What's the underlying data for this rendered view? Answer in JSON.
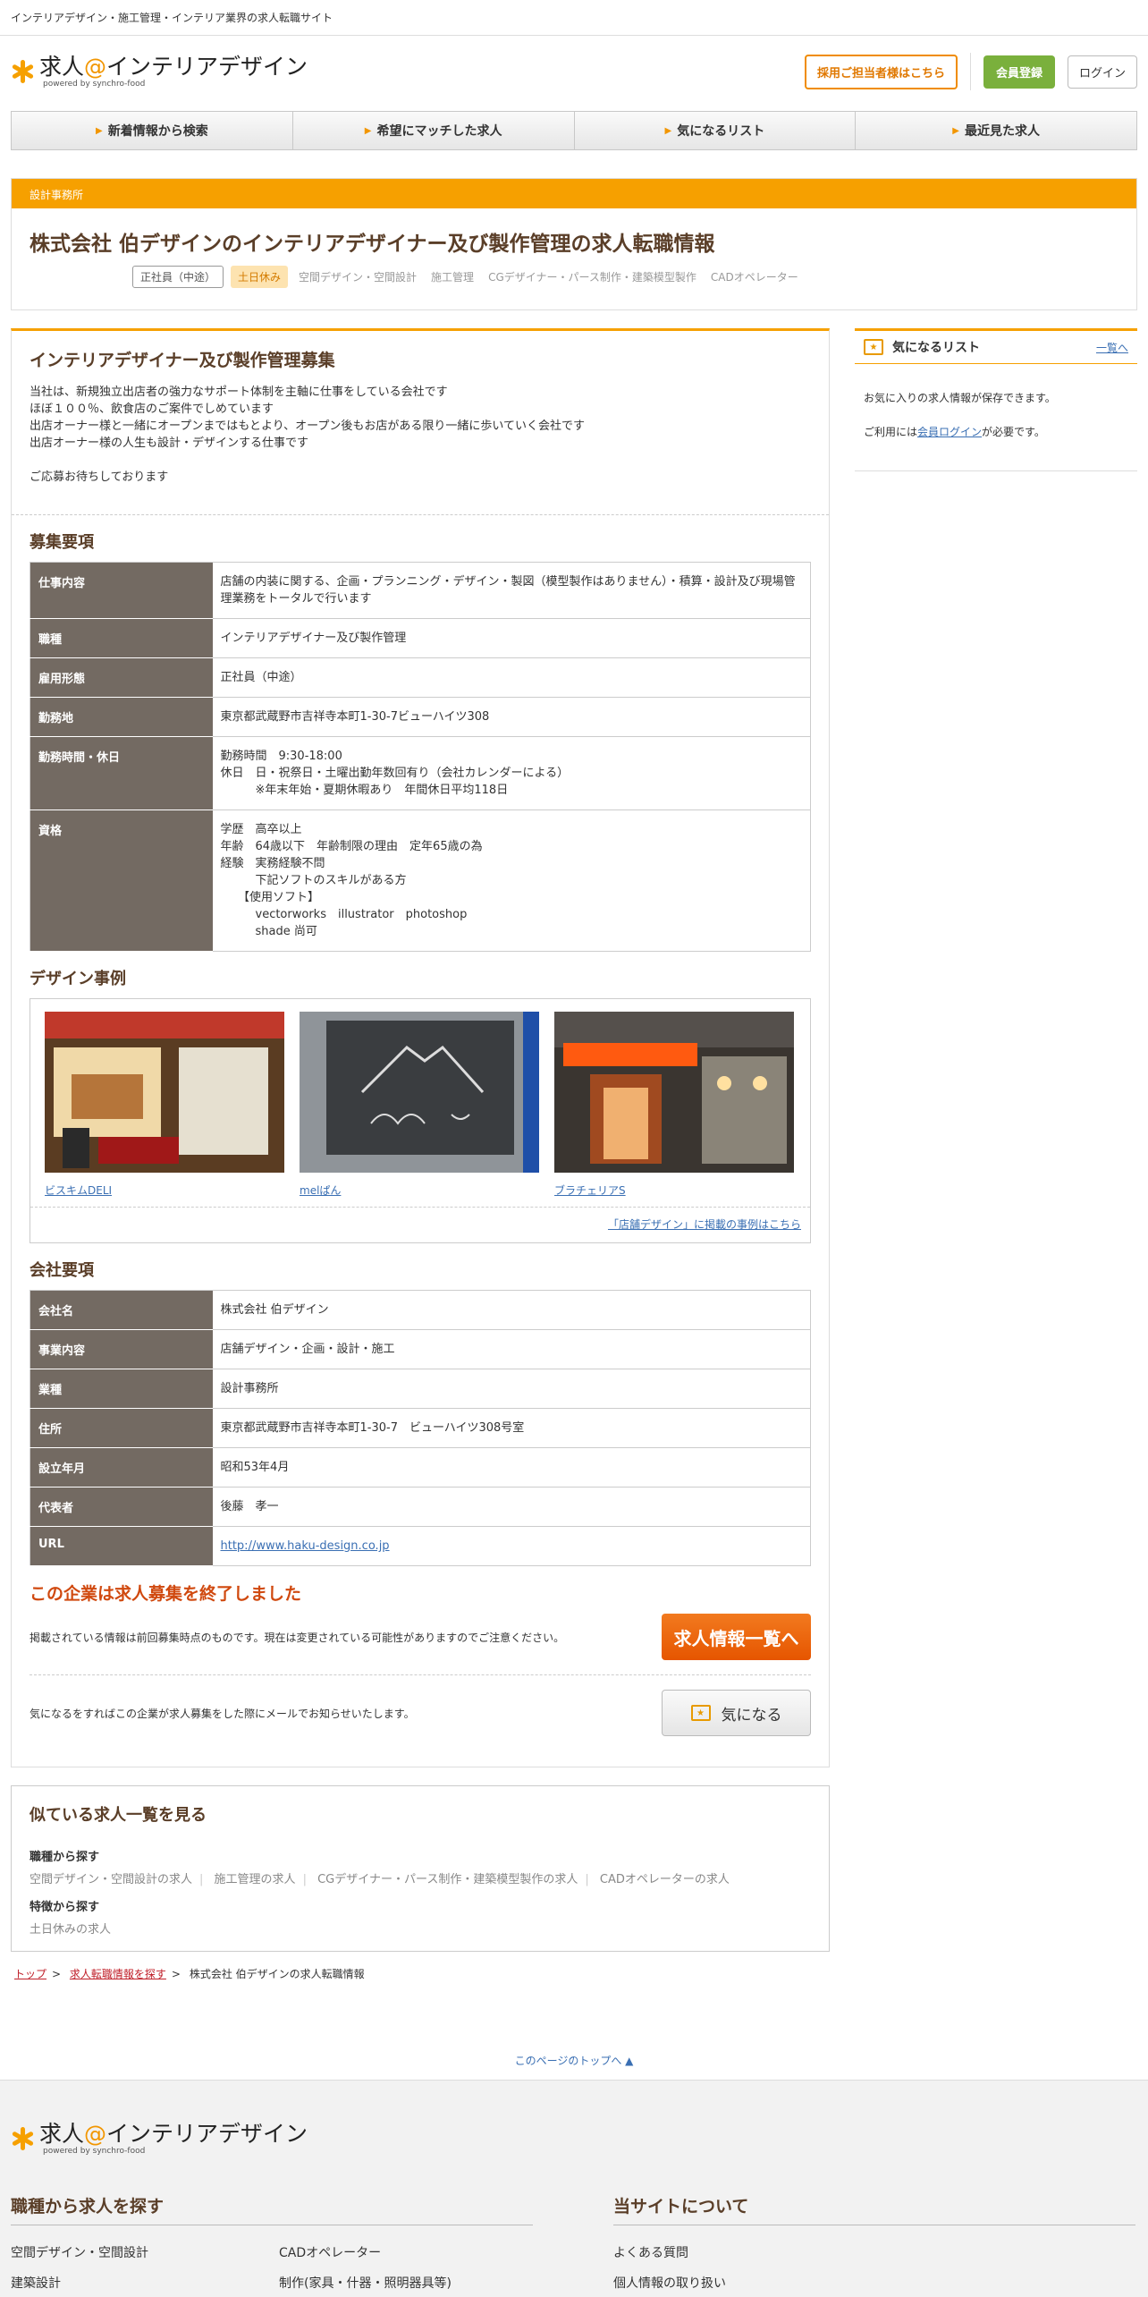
{
  "topbar": {
    "tagline": "インテリアデザイン・施工管理・インテリア業界の求人転職サイト"
  },
  "logo": {
    "main_pre": "求人",
    "main_at": "@",
    "main_post": "インテリアデザイン",
    "sub": "powered by synchro-food"
  },
  "header": {
    "recruit_label": "採用ご担当者様はこちら",
    "member_label": "会員登録",
    "login_label": "ログイン"
  },
  "nav": [
    {
      "label": "新着情報から検索"
    },
    {
      "label": "希望にマッチした求人"
    },
    {
      "label": "気になるリスト"
    },
    {
      "label": "最近見た求人"
    }
  ],
  "job": {
    "category": "設計事務所",
    "title": "株式会社 伯デザインのインテリアデザイナー及び製作管理の求人転職情報",
    "tag_employment": "正社員（中途）",
    "tag_holiday": "土日休み",
    "tags_plain": [
      "空間デザイン・空間設計",
      "施工管理",
      "CGデザイナー・パース制作・建築模型製作",
      "CADオペレーター"
    ]
  },
  "intro": {
    "heading": "インテリアデザイナー及び製作管理募集",
    "body": "当社は、新規独立出店者の強力なサポート体制を主軸に仕事をしている会社です\nほぼ１００％、飲食店のご案件でしめています\n出店オーナー様と一緒にオープンまではもとより、オープン後もお店がある限り一緒に歩いていく会社です\n出店オーナー様の人生も設計・デザインする仕事です\n\nご応募お待ちしております"
  },
  "requirements": {
    "heading": "募集要項",
    "rows": [
      {
        "label": "仕事内容",
        "value": "店舗の内装に関する、企画・プランニング・デザイン・製図（模型製作はありません）・積算・設計及び現場管理業務をトータルで行います"
      },
      {
        "label": "職種",
        "value": "インテリアデザイナー及び製作管理"
      },
      {
        "label": "雇用形態",
        "value": "正社員（中途）"
      },
      {
        "label": "勤務地",
        "value": "東京都武蔵野市吉祥寺本町1-30-7ビューハイツ308"
      },
      {
        "label": "勤務時間・休日",
        "value": "勤務時間　9:30-18:00\n休日　日・祝祭日・土曜出勤年数回有り（会社カレンダーによる）\n　　　※年末年始・夏期休暇あり　年間休日平均118日"
      },
      {
        "label": "資格",
        "value": "学歴　高卒以上\n年齢　64歳以下　年齢制限の理由　定年65歳の為\n経験　実務経験不問\n　　　下記ソフトのスキルがある方\n　　【使用ソフト】\n　　　vectorworks　illustrator　photoshop\n　　　shade 尚可\n"
      }
    ]
  },
  "cases": {
    "heading": "デザイン事例",
    "items": [
      {
        "label": "ビスキムDELI"
      },
      {
        "label": "melぱん"
      },
      {
        "label": "ブラチェリアS"
      }
    ],
    "more_label": "「店舗デザイン」に掲載の事例はこちら"
  },
  "company": {
    "heading": "会社要項",
    "rows": [
      {
        "label": "会社名",
        "value": "株式会社 伯デザイン"
      },
      {
        "label": "事業内容",
        "value": "店舗デザイン・企画・設計・施工"
      },
      {
        "label": "業種",
        "value": "設計事務所"
      },
      {
        "label": "住所",
        "value": "東京都武蔵野市吉祥寺本町1-30-7　ビューハイツ308号室"
      },
      {
        "label": "設立年月",
        "value": "昭和53年4月"
      },
      {
        "label": "代表者",
        "value": "後藤　孝一"
      }
    ],
    "url_label": "URL",
    "url_value": "http://www.haku-design.co.jp"
  },
  "ended": {
    "heading": "この企業は求人募集を終了しました",
    "notice": "掲載されている情報は前回募集時点のものです。現在は変更されている可能性がありますのでご注意ください。",
    "list_button": "求人情報一覧へ",
    "fav_notice": "気になるをすればこの企業が求人募集をした際にメールでお知らせいたします。",
    "fav_button": "気になる"
  },
  "similar": {
    "heading": "似ている求人一覧を見る",
    "by_job_label": "職種から探す",
    "by_job": [
      "空間デザイン・空間設計の求人",
      "施工管理の求人",
      "CGデザイナー・パース制作・建築模型製作の求人",
      "CADオペレーターの求人"
    ],
    "by_feature_label": "特徴から探す",
    "by_feature": [
      "土日休みの求人"
    ]
  },
  "breadcrumb": {
    "top": "トップ",
    "search": "求人転職情報を探す",
    "current": "株式会社 伯デザインの求人転職情報"
  },
  "sidebar": {
    "title": "気になるリスト",
    "all_label": "一覧へ",
    "body_1": "お気に入りの求人情報が保存できます。",
    "body_2_pre": "ご利用には",
    "body_2_link": "会員ログイン",
    "body_2_post": "が必要です。"
  },
  "pagetop": {
    "label": "このページのトップへ ▲"
  },
  "footer": {
    "col1_heading": "職種から求人を探す",
    "col1_links": [
      "空間デザイン・空間設計",
      "CADオペレーター",
      "建築設計",
      "制作(家具・什器・照明器具等)"
    ],
    "col2_heading": "当サイトについて",
    "col2_links": [
      "よくある質問",
      "個人情報の取り扱い"
    ]
  },
  "colors": {
    "accent": "#f6a000",
    "brown": "#5a3e28",
    "table_head": "#736a62",
    "alert": "#d0490f"
  }
}
